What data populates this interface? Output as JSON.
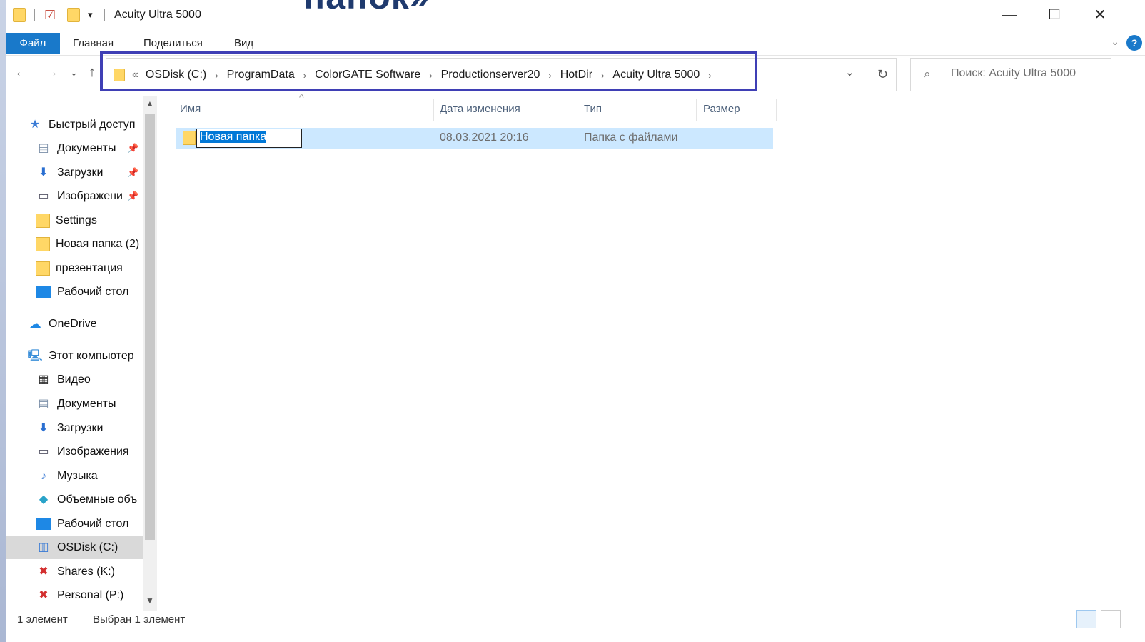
{
  "overlay": {
    "heading_fragment": "папок»"
  },
  "window": {
    "title": "Acuity Ultra 5000"
  },
  "ribbon": {
    "tabs": [
      "Файл",
      "Главная",
      "Поделиться",
      "Вид"
    ],
    "help": "?"
  },
  "address": {
    "lead": "«",
    "crumbs": [
      "OSDisk (C:)",
      "ProgramData",
      "ColorGATE Software",
      "Productionserver20",
      "HotDir",
      "Acuity Ultra 5000"
    ],
    "highlight_color": "#3f3fb5"
  },
  "search": {
    "placeholder": "Поиск: Acuity Ultra 5000"
  },
  "navpane": {
    "quick_access": "Быстрый доступ",
    "quick_items": [
      "Документы",
      "Загрузки",
      "Изображени",
      "Settings",
      "Новая папка (2)",
      "презентация",
      "Рабочий стол"
    ],
    "onedrive": "OneDrive",
    "this_pc": "Этот компьютер",
    "pc_items": [
      "Видео",
      "Документы",
      "Загрузки",
      "Изображения",
      "Музыка",
      "Объемные объ",
      "Рабочий стол",
      "OSDisk (C:)",
      "Shares (K:)",
      "Personal (P:)"
    ]
  },
  "columns": {
    "name": "Имя",
    "date": "Дата изменения",
    "type": "Тип",
    "size": "Размер"
  },
  "files": [
    {
      "name": "Новая папка",
      "date": "08.03.2021 20:16",
      "type": "Папка с файлами",
      "size": ""
    }
  ],
  "status": {
    "count": "1 элемент",
    "selected": "Выбран 1 элемент"
  },
  "colors": {
    "accent": "#1979ca",
    "selection": "#cce8ff",
    "folder": "#ffd766"
  }
}
